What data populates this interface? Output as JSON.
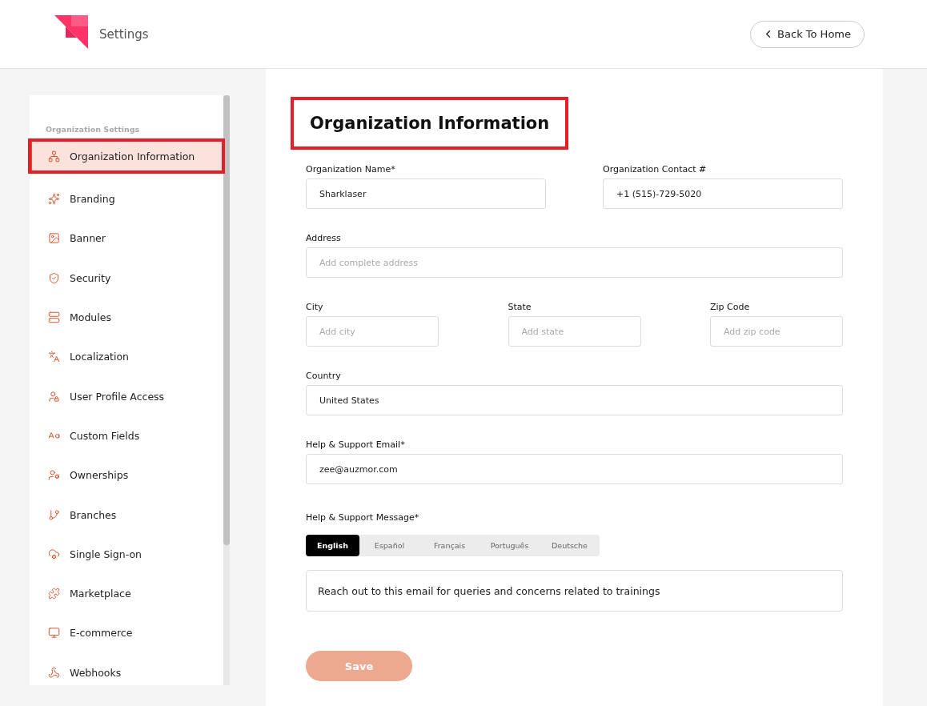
{
  "header": {
    "title": "Settings",
    "back_button": "Back To Home"
  },
  "sidebar": {
    "section_title": "Organization Settings",
    "items": [
      {
        "label": "Organization Information",
        "selected": true,
        "highlighted": true
      },
      {
        "label": "Branding",
        "selected": false,
        "highlighted": false
      },
      {
        "label": "Banner",
        "selected": false,
        "highlighted": false
      },
      {
        "label": "Security",
        "selected": false,
        "highlighted": false
      },
      {
        "label": "Modules",
        "selected": false,
        "highlighted": false
      },
      {
        "label": "Localization",
        "selected": false,
        "highlighted": false
      },
      {
        "label": "User Profile Access",
        "selected": false,
        "highlighted": false
      },
      {
        "label": "Custom Fields",
        "selected": false,
        "highlighted": false
      },
      {
        "label": "Ownerships",
        "selected": false,
        "highlighted": false
      },
      {
        "label": "Branches",
        "selected": false,
        "highlighted": false
      },
      {
        "label": "Single Sign-on",
        "selected": false,
        "highlighted": false
      },
      {
        "label": "Marketplace",
        "selected": false,
        "highlighted": false
      },
      {
        "label": "E-commerce",
        "selected": false,
        "highlighted": false
      },
      {
        "label": "Webhooks",
        "selected": false,
        "highlighted": false
      }
    ]
  },
  "form": {
    "title": "Organization Information",
    "title_highlighted": true,
    "rows": [
      [
        {
          "label": "Organization Name*",
          "value": "Sharklaser"
        },
        {
          "label": "Organization Contact #",
          "value": "+1 (515)-729-5020"
        }
      ],
      [
        {
          "label": "Address",
          "placeholder": "Add complete address"
        }
      ],
      [
        {
          "label": "City",
          "placeholder": "Add city"
        },
        {
          "label": "State",
          "placeholder": "Add state"
        },
        {
          "label": "Zip Code",
          "placeholder": "Add zip code"
        }
      ],
      [
        {
          "label": "Country",
          "value": "United States"
        }
      ],
      [
        {
          "label": "Help & Support Email*",
          "value": "zee@auzmor.com"
        }
      ]
    ],
    "message_label": "Help & Support Message*",
    "languages": [
      {
        "label": "English",
        "selected": true
      },
      {
        "label": "Español",
        "selected": false
      },
      {
        "label": "Français",
        "selected": false
      },
      {
        "label": "Português",
        "selected": false
      },
      {
        "label": "Deutsche",
        "selected": false
      }
    ],
    "message": "Reach out to this email for queries and concerns related to trainings",
    "save_button": {
      "label": "Save",
      "disabled": true
    }
  }
}
